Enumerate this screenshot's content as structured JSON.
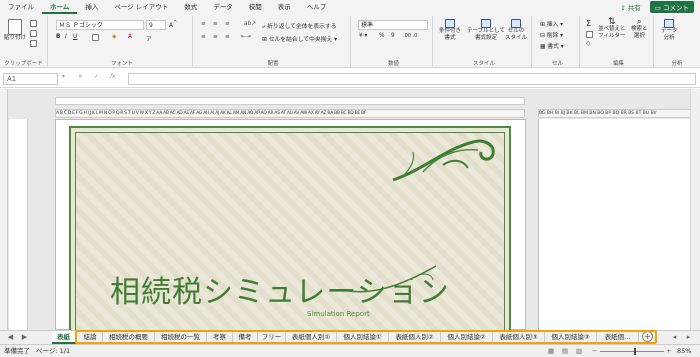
{
  "ribbon_tabs": [
    "ファイル",
    "ホーム",
    "挿入",
    "ページ レイアウト",
    "数式",
    "データ",
    "校閲",
    "表示",
    "ヘルプ"
  ],
  "active_tab": "ホーム",
  "share_label": "共有",
  "comment_label": "コメント",
  "clipboard": {
    "paste": "貼り付け",
    "label": "クリップボード"
  },
  "font": {
    "name": "ＭＳ Ｐゴシック",
    "size": "9",
    "label": "フォント"
  },
  "alignment": {
    "wrap": "折り返して全体を表示する",
    "merge": "セルを結合して中央揃え",
    "label": "配置"
  },
  "number": {
    "format": "標準",
    "label": "数値"
  },
  "styles": {
    "conditional": "条件付き\n書式",
    "table": "テーブルとして\n書式設定",
    "cell": "セルの\nスタイル",
    "label": "スタイル"
  },
  "cells": {
    "insert": "挿入",
    "delete": "削除",
    "format": "書式",
    "label": "セル"
  },
  "editing": {
    "sort": "並べ替えと\nフィルター",
    "find": "検索と\n選択",
    "label": "編集"
  },
  "analysis": {
    "data": "データ\n分析",
    "label": "分析"
  },
  "name_box": "A1",
  "column_header_text": "A B C D E F G H I J K L M N O P Q R S T U V W X Y Z AA AB AC AD AE AF AG AH AI AJ AK AL AM AN AO AP AQ AR AS AT AU AV AW AX AY AZ BA BB BC BD BE BF",
  "column_header_text2": "BG BH BI BJ BK BL BM BN BO BP BQ BR BS BT BU BV",
  "cover_title": "相続税シミュレーション",
  "cover_subtitle": "Simulation Report",
  "sheet_tabs": [
    "表紙",
    "結論",
    "相続税の概要",
    "相続税の一覧",
    "考察",
    "備考",
    "フリー",
    "表紙個人別①",
    "個人別結論①",
    "表紙個人別②",
    "個人別結論②",
    "表紙個人別③",
    "個人別結論③",
    "表紙個..."
  ],
  "active_sheet": "表紙",
  "status": {
    "ready": "準備完了",
    "page": "ページ: 1/1",
    "zoom": "85%"
  },
  "colors": {
    "excel_green": "#217346",
    "cover_green": "#3f7d33",
    "highlight": "#f0a500"
  }
}
